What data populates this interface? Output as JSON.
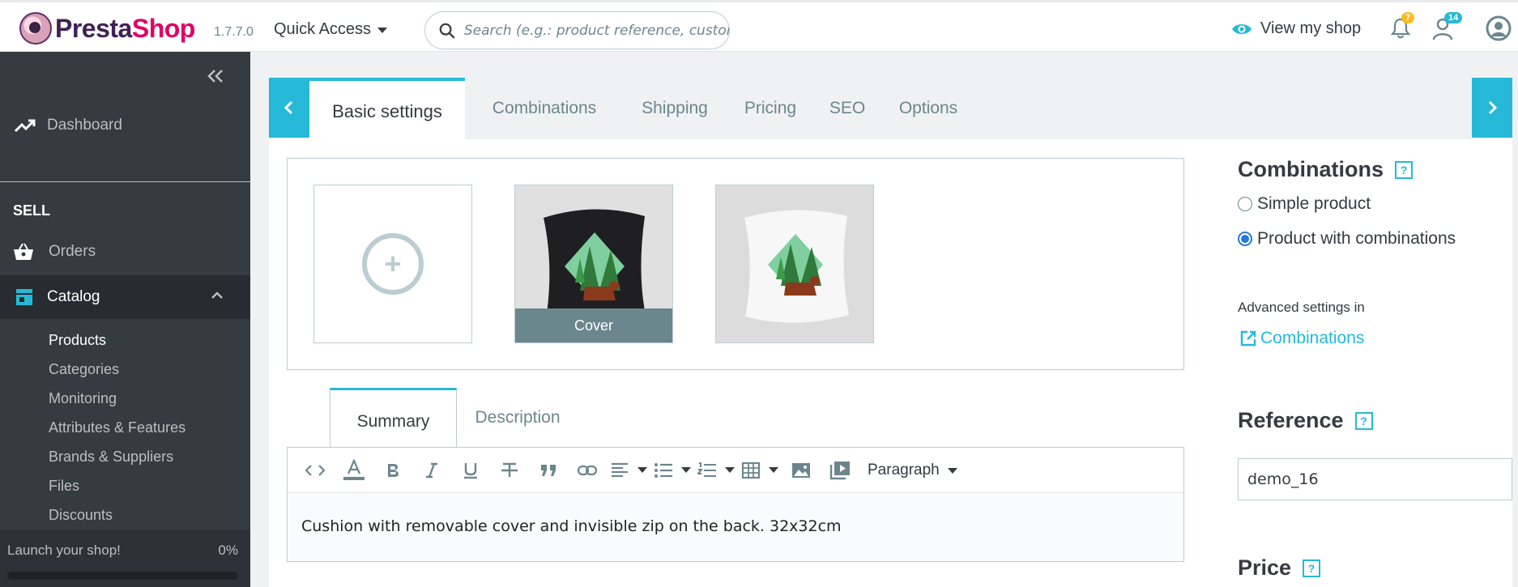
{
  "header": {
    "logo_text_part1": "Presta",
    "logo_text_part2": "Shop",
    "version": "1.7.7.0",
    "quick_access_label": "Quick Access",
    "search_placeholder": "Search (e.g.: product reference, customer name...)",
    "view_shop_label": "View my shop",
    "notifications_count": "7",
    "employee_count": "14"
  },
  "sidebar": {
    "dashboard_label": "Dashboard",
    "section_sell": "SELL",
    "orders_label": "Orders",
    "catalog_label": "Catalog",
    "catalog_items": [
      "Products",
      "Categories",
      "Monitoring",
      "Attributes & Features",
      "Brands & Suppliers",
      "Files",
      "Discounts"
    ],
    "launch_label": "Launch your shop!",
    "launch_percent": "0%",
    "launch_progress": 0
  },
  "tabs": {
    "items": [
      {
        "label": "Basic settings",
        "active": true
      },
      {
        "label": "Combinations",
        "active": false
      },
      {
        "label": "Shipping",
        "active": false
      },
      {
        "label": "Pricing",
        "active": false
      },
      {
        "label": "SEO",
        "active": false
      },
      {
        "label": "Options",
        "active": false
      }
    ]
  },
  "images": {
    "cover_label": "Cover",
    "add_icon": "plus-circle-icon"
  },
  "editor": {
    "tabs": [
      "Summary",
      "Description"
    ],
    "paragraph_label": "Paragraph",
    "content": "Cushion with removable cover and invisible zip on the back. 32x32cm"
  },
  "right": {
    "combinations_title": "Combinations",
    "help_label": "?",
    "option_simple": "Simple product",
    "option_combinations": "Product with combinations",
    "selected_option": "combinations",
    "advanced_label": "Advanced settings in",
    "advanced_link": "Combinations",
    "reference_title": "Reference",
    "reference_value": "demo_16",
    "price_title": "Price"
  },
  "colors": {
    "accent": "#25b9d7",
    "sidebar_bg": "#363a41",
    "brand_purple": "#3f2155",
    "brand_pink": "#df0067"
  }
}
